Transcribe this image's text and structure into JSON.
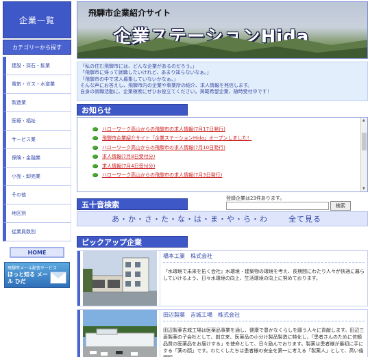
{
  "sidebar": {
    "title": "企業一覧",
    "subtitle": "カテゴリーから探す",
    "items": [
      {
        "label": "建設・採石・鉱業"
      },
      {
        "label": "電気・ガス・水道業"
      },
      {
        "label": "製造業"
      },
      {
        "label": "医療・福祉"
      },
      {
        "label": "サービス業"
      },
      {
        "label": "保険・金融業"
      },
      {
        "label": "小売・卸売業"
      },
      {
        "label": "その他"
      },
      {
        "label": "地区別"
      },
      {
        "label": "従業員数別"
      }
    ],
    "home_label": "HOME",
    "mail_banner": {
      "line1": "飛騨市メール配信サービス",
      "line2": "ほっと知る メール ひだ"
    }
  },
  "header": {
    "subtitle": "飛騨市企業紹介サイト",
    "title": "企業ステーションHida"
  },
  "intro": {
    "lines": [
      "「私の住む飛騨市には、どんな企業があるのだろう。」",
      "「飛騨市に帰って就職したいけれど、あまり知らないなぁ。」",
      "「飛騨市の中で求人募集していないかなぁ。」",
      "そんな声にお答えし、飛騨市内の企業や事業所の紹介、求人情報を発信します。",
      "自身の就職活動に、企業検索にぜひお役立てください。掲載希望企業、随時受付中です！"
    ]
  },
  "news": {
    "heading": "お知らせ",
    "items": [
      {
        "text": "ハローワーク高山からの飛騨市の求人情報(7月17日発行)"
      },
      {
        "text": "飛騨市企業紹介サイト「企業ステーションHida」オープンしました！"
      },
      {
        "text": "ハローワーク高山からの飛騨市の求人情報(7月10日発行)"
      },
      {
        "text": "求人情報(7月8日受付分)"
      },
      {
        "text": "求人情報(7月4日受付分)"
      },
      {
        "text": "ハローワーク高山からの飛騨市の求人情報(7月3日発行)"
      }
    ]
  },
  "search": {
    "heading": "五十音検索",
    "registered": "登録企業は23件あります。",
    "input_value": "",
    "button_label": "検索",
    "kana": [
      "あ",
      "か",
      "さ",
      "た",
      "な",
      "は",
      "ま",
      "や",
      "ら",
      "わ"
    ],
    "kana_sep": "・",
    "all_label": "全て見る"
  },
  "pickup": {
    "heading": "ピックアップ企業",
    "companies": [
      {
        "name": "橋本工業　株式会社",
        "desc": "『水環境で未来を拓く会社』水環境・建築物の環境を考え、長期間にわたり人々が快適に暮らしていけるよう、日々水環境の向上、生活環境の向上に努めております。"
      },
      {
        "name": "田辺製薬　吉城工場　株式会社",
        "desc": "田辺製薬吉城工場は医薬品事業を通し、健康で豊かなくらしを願う人々に貢献します。田辺三菱製薬の子会社として、創立来、医薬品の小分け製品製造に特化し、「患者さんのために信頼品質の医薬品をお届けする」を使命として、日々励んでおります。製薬は患者様が最初に手にする「薬の顔」です。わたくしたちは患者様の安全を第一に考える「製薬人」として、高い倫理観…"
      }
    ]
  },
  "colors": {
    "accent": "#3f58c8",
    "link_red": "#cc2222",
    "intro_bg": "#e3eefc"
  }
}
